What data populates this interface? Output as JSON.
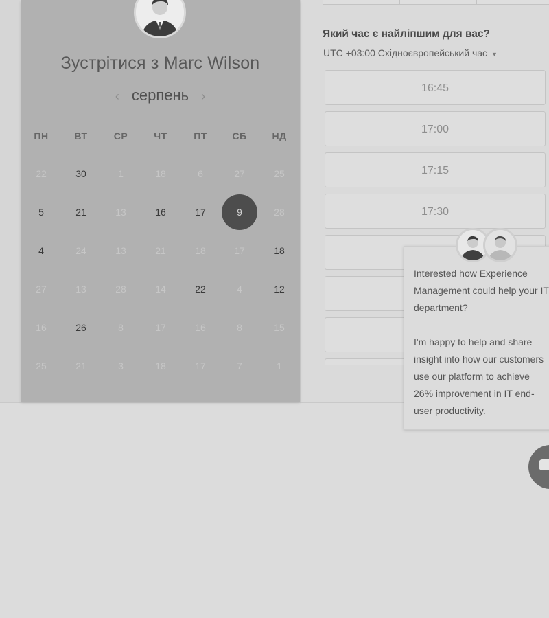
{
  "booking": {
    "title": "Зустрітися з Marc Wilson",
    "month": "серпень",
    "nav_prev": "‹",
    "nav_next": "›"
  },
  "calendar": {
    "weekdays": [
      "ПН",
      "ВТ",
      "СР",
      "ЧТ",
      "ПТ",
      "СБ",
      "НД"
    ],
    "weeks": [
      [
        {
          "d": "22",
          "s": "inactive"
        },
        {
          "d": "30",
          "s": "active"
        },
        {
          "d": "1",
          "s": "inactive"
        },
        {
          "d": "18",
          "s": "inactive"
        },
        {
          "d": "6",
          "s": "inactive"
        },
        {
          "d": "27",
          "s": "inactive"
        },
        {
          "d": "25",
          "s": "inactive"
        }
      ],
      [
        {
          "d": "5",
          "s": "active"
        },
        {
          "d": "21",
          "s": "active"
        },
        {
          "d": "13",
          "s": "inactive"
        },
        {
          "d": "16",
          "s": "active"
        },
        {
          "d": "17",
          "s": "active"
        },
        {
          "d": "9",
          "s": "selected"
        },
        {
          "d": "28",
          "s": "inactive"
        }
      ],
      [
        {
          "d": "4",
          "s": "active"
        },
        {
          "d": "24",
          "s": "inactive"
        },
        {
          "d": "13",
          "s": "inactive"
        },
        {
          "d": "21",
          "s": "inactive"
        },
        {
          "d": "18",
          "s": "inactive"
        },
        {
          "d": "17",
          "s": "inactive"
        },
        {
          "d": "18",
          "s": "active"
        }
      ],
      [
        {
          "d": "27",
          "s": "inactive"
        },
        {
          "d": "13",
          "s": "inactive"
        },
        {
          "d": "28",
          "s": "inactive"
        },
        {
          "d": "14",
          "s": "inactive"
        },
        {
          "d": "22",
          "s": "active"
        },
        {
          "d": "4",
          "s": "inactive"
        },
        {
          "d": "12",
          "s": "active"
        }
      ],
      [
        {
          "d": "16",
          "s": "inactive"
        },
        {
          "d": "26",
          "s": "active"
        },
        {
          "d": "8",
          "s": "inactive"
        },
        {
          "d": "17",
          "s": "inactive"
        },
        {
          "d": "16",
          "s": "inactive"
        },
        {
          "d": "8",
          "s": "inactive"
        },
        {
          "d": "15",
          "s": "inactive"
        }
      ],
      [
        {
          "d": "25",
          "s": "inactive"
        },
        {
          "d": "21",
          "s": "inactive"
        },
        {
          "d": "3",
          "s": "inactive"
        },
        {
          "d": "18",
          "s": "inactive"
        },
        {
          "d": "17",
          "s": "inactive"
        },
        {
          "d": "7",
          "s": "inactive"
        },
        {
          "d": "1",
          "s": "inactive"
        }
      ]
    ]
  },
  "times": {
    "question": "Який час є найліпшим для вас?",
    "timezone": "UTC +03:00 Східноєвропейський час",
    "slots": [
      "16:45",
      "17:00",
      "17:15",
      "17:30",
      "",
      "",
      "",
      ""
    ]
  },
  "chat": {
    "message_1": "Interested how Experience Management could help your IT department?",
    "message_2": "I'm happy to help and share insight into how our customers use our platform to achieve 26% improvement in IT end-user productivity."
  },
  "colors": {
    "selected_day": "#4d4d4d",
    "panel": "#b1b1b1"
  }
}
